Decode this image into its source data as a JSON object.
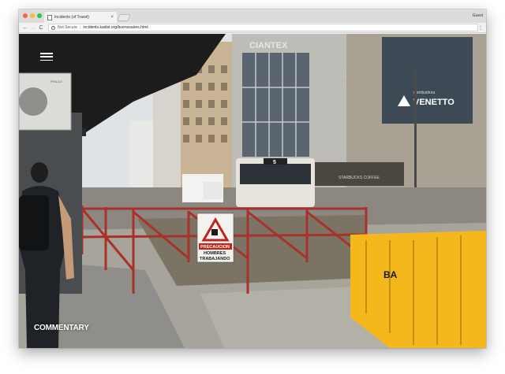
{
  "browser": {
    "tab_title": "Incidents (of Travel)",
    "tab_close": "×",
    "profile": "Guest",
    "back": "←",
    "forward": "→",
    "reload": "C",
    "info_glyph": "i",
    "not_secure": "Not Secure",
    "separator": "|",
    "url": "incidents.kadist.org/buenosaires.html",
    "menu": "⋮"
  },
  "page": {
    "commentary_link": "COMMENTARY"
  },
  "photo": {
    "store_sign": "CIANTEX",
    "sign_x": "X",
    "banner_brand": "VENETTO",
    "banner_small": "distribuidora",
    "bus_number": "5",
    "coffee_sign": "STARBUCKS COFFEE",
    "warning_title": "PRECAUCION",
    "warning_line1": "HOMBRES",
    "warning_line2": "TRABAJANDO",
    "barrier_logo": "BA",
    "ac_brand": "PHILCO"
  },
  "colors": {
    "barrier_yellow": "#f5b81c",
    "fence_red": "#a8322a",
    "overhang_dark": "#1c1c1c",
    "banner_blue": "#3d4a56"
  }
}
